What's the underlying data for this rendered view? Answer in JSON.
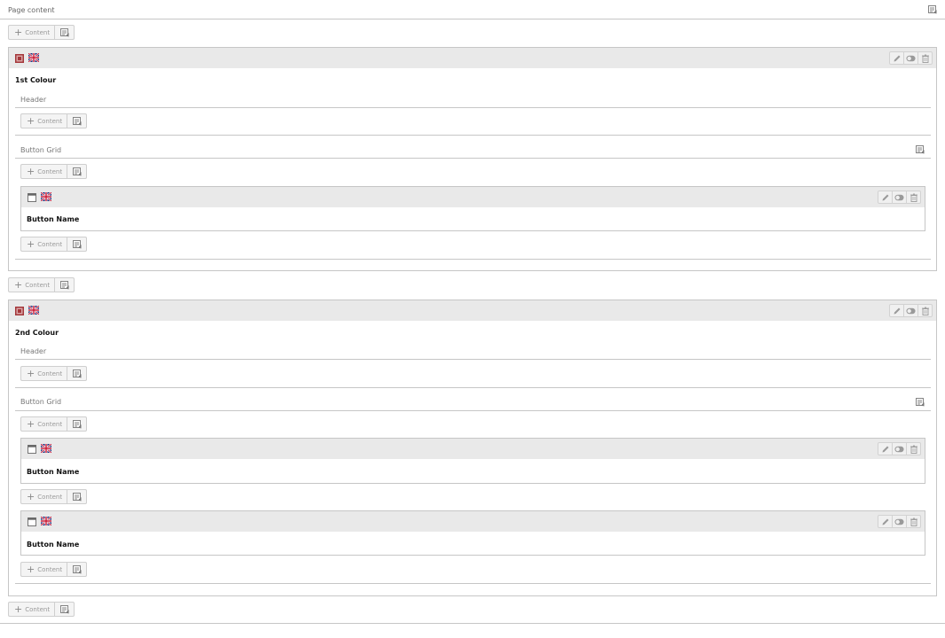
{
  "page": {
    "title": "Page content"
  },
  "add_content_label": "Content",
  "elements": [
    {
      "title": "1st Colour",
      "columns": [
        {
          "label": "Header"
        },
        {
          "label": "Button Grid",
          "children": [
            {
              "title": "Button Name"
            }
          ]
        }
      ]
    },
    {
      "title": "2nd Colour",
      "columns": [
        {
          "label": "Header"
        },
        {
          "label": "Button Grid",
          "children": [
            {
              "title": "Button Name"
            },
            {
              "title": "Button Name"
            }
          ]
        }
      ]
    }
  ],
  "icons": {
    "flag": "uk-flag-icon",
    "edit": "pencil-icon",
    "toggle": "toggle-visibility-icon",
    "delete": "trash-icon",
    "paste": "paste-icon",
    "grid_ctype": "grid-container-icon",
    "button_ctype": "content-element-icon"
  },
  "colors": {
    "header_bar": "#e9e9e9",
    "border": "#c6c6c6",
    "container_icon": "#a4373a"
  }
}
